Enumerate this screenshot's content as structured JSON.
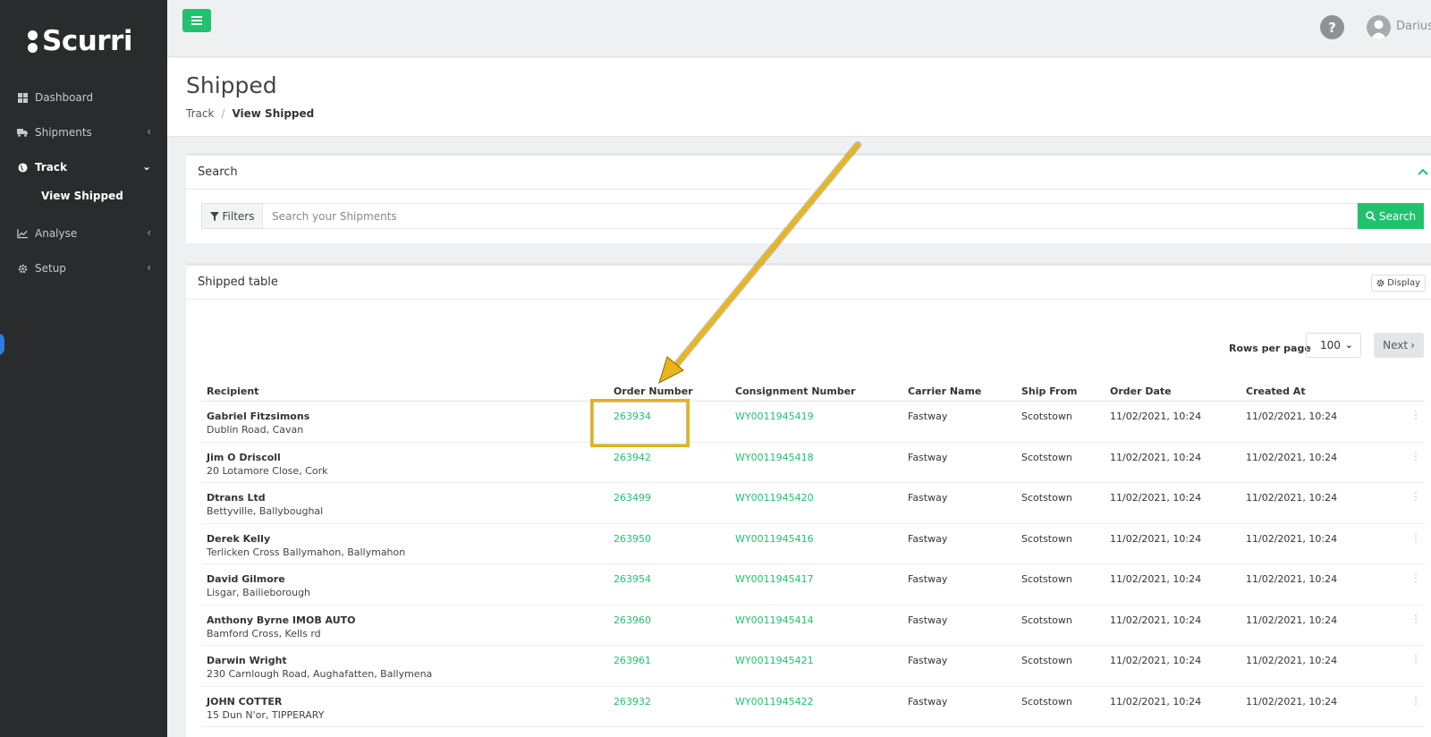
{
  "sidebar": {
    "logo_text": "Scurri",
    "items": [
      {
        "label": "Dashboard",
        "icon": "dashboard-icon"
      },
      {
        "label": "Shipments",
        "icon": "truck-icon"
      },
      {
        "label": "Track",
        "icon": "globe-icon"
      },
      {
        "label": "Analyse",
        "icon": "chart-line-icon"
      },
      {
        "label": "Setup",
        "icon": "gear-icon"
      }
    ],
    "sub_item": "View Shipped"
  },
  "topbar": {
    "help_label": "?",
    "user_name": "Darius"
  },
  "page": {
    "title": "Shipped",
    "breadcrumb": {
      "parent": "Track",
      "separator": "/",
      "current": "View Shipped"
    }
  },
  "search": {
    "panel_title": "Search",
    "filters_label": "Filters",
    "placeholder": "Search your Shipments",
    "button_label": "Search"
  },
  "table": {
    "panel_title": "Shipped table",
    "display_label": "Display",
    "rows_per_page_label": "Rows per page",
    "rows_per_page_value": "100",
    "next_label": "Next",
    "columns": [
      "Recipient",
      "Order Number",
      "Consignment Number",
      "Carrier Name",
      "Ship From",
      "Order Date",
      "Created At"
    ],
    "rows": [
      {
        "name": "Gabriel Fitzsimons",
        "address": "Dublin Road, Cavan",
        "order": "263934",
        "consignment": "WY0011945419",
        "carrier": "Fastway",
        "ship_from": "Scotstown",
        "order_date": "11/02/2021, 10:24",
        "created_at": "11/02/2021, 10:24"
      },
      {
        "name": "Jim O Driscoll",
        "address": "20 Lotamore Close, Cork",
        "order": "263942",
        "consignment": "WY0011945418",
        "carrier": "Fastway",
        "ship_from": "Scotstown",
        "order_date": "11/02/2021, 10:24",
        "created_at": "11/02/2021, 10:24"
      },
      {
        "name": "Dtrans Ltd",
        "address": "Bettyville, Ballyboughal",
        "order": "263499",
        "consignment": "WY0011945420",
        "carrier": "Fastway",
        "ship_from": "Scotstown",
        "order_date": "11/02/2021, 10:24",
        "created_at": "11/02/2021, 10:24"
      },
      {
        "name": "Derek Kelly",
        "address": "Terlicken Cross Ballymahon, Ballymahon",
        "order": "263950",
        "consignment": "WY0011945416",
        "carrier": "Fastway",
        "ship_from": "Scotstown",
        "order_date": "11/02/2021, 10:24",
        "created_at": "11/02/2021, 10:24"
      },
      {
        "name": "David Gilmore",
        "address": "Lisgar, Bailieborough",
        "order": "263954",
        "consignment": "WY0011945417",
        "carrier": "Fastway",
        "ship_from": "Scotstown",
        "order_date": "11/02/2021, 10:24",
        "created_at": "11/02/2021, 10:24"
      },
      {
        "name": "Anthony Byrne IMOB AUTO",
        "address": "Bamford Cross, Kells rd",
        "order": "263960",
        "consignment": "WY0011945414",
        "carrier": "Fastway",
        "ship_from": "Scotstown",
        "order_date": "11/02/2021, 10:24",
        "created_at": "11/02/2021, 10:24"
      },
      {
        "name": "Darwin Wright",
        "address": "230 Carnlough Road, Aughafatten, Ballymena",
        "order": "263961",
        "consignment": "WY0011945421",
        "carrier": "Fastway",
        "ship_from": "Scotstown",
        "order_date": "11/02/2021, 10:24",
        "created_at": "11/02/2021, 10:24"
      },
      {
        "name": "JOHN COTTER",
        "address": "15 Dun N'or, TIPPERARY",
        "order": "263932",
        "consignment": "WY0011945422",
        "carrier": "Fastway",
        "ship_from": "Scotstown",
        "order_date": "11/02/2021, 10:24",
        "created_at": "11/02/2021, 10:24"
      }
    ]
  },
  "colors": {
    "sidebar_bg": "#2a2b2d",
    "accent_green": "#21c26e",
    "annotation_yellow": "#e2b21b"
  }
}
